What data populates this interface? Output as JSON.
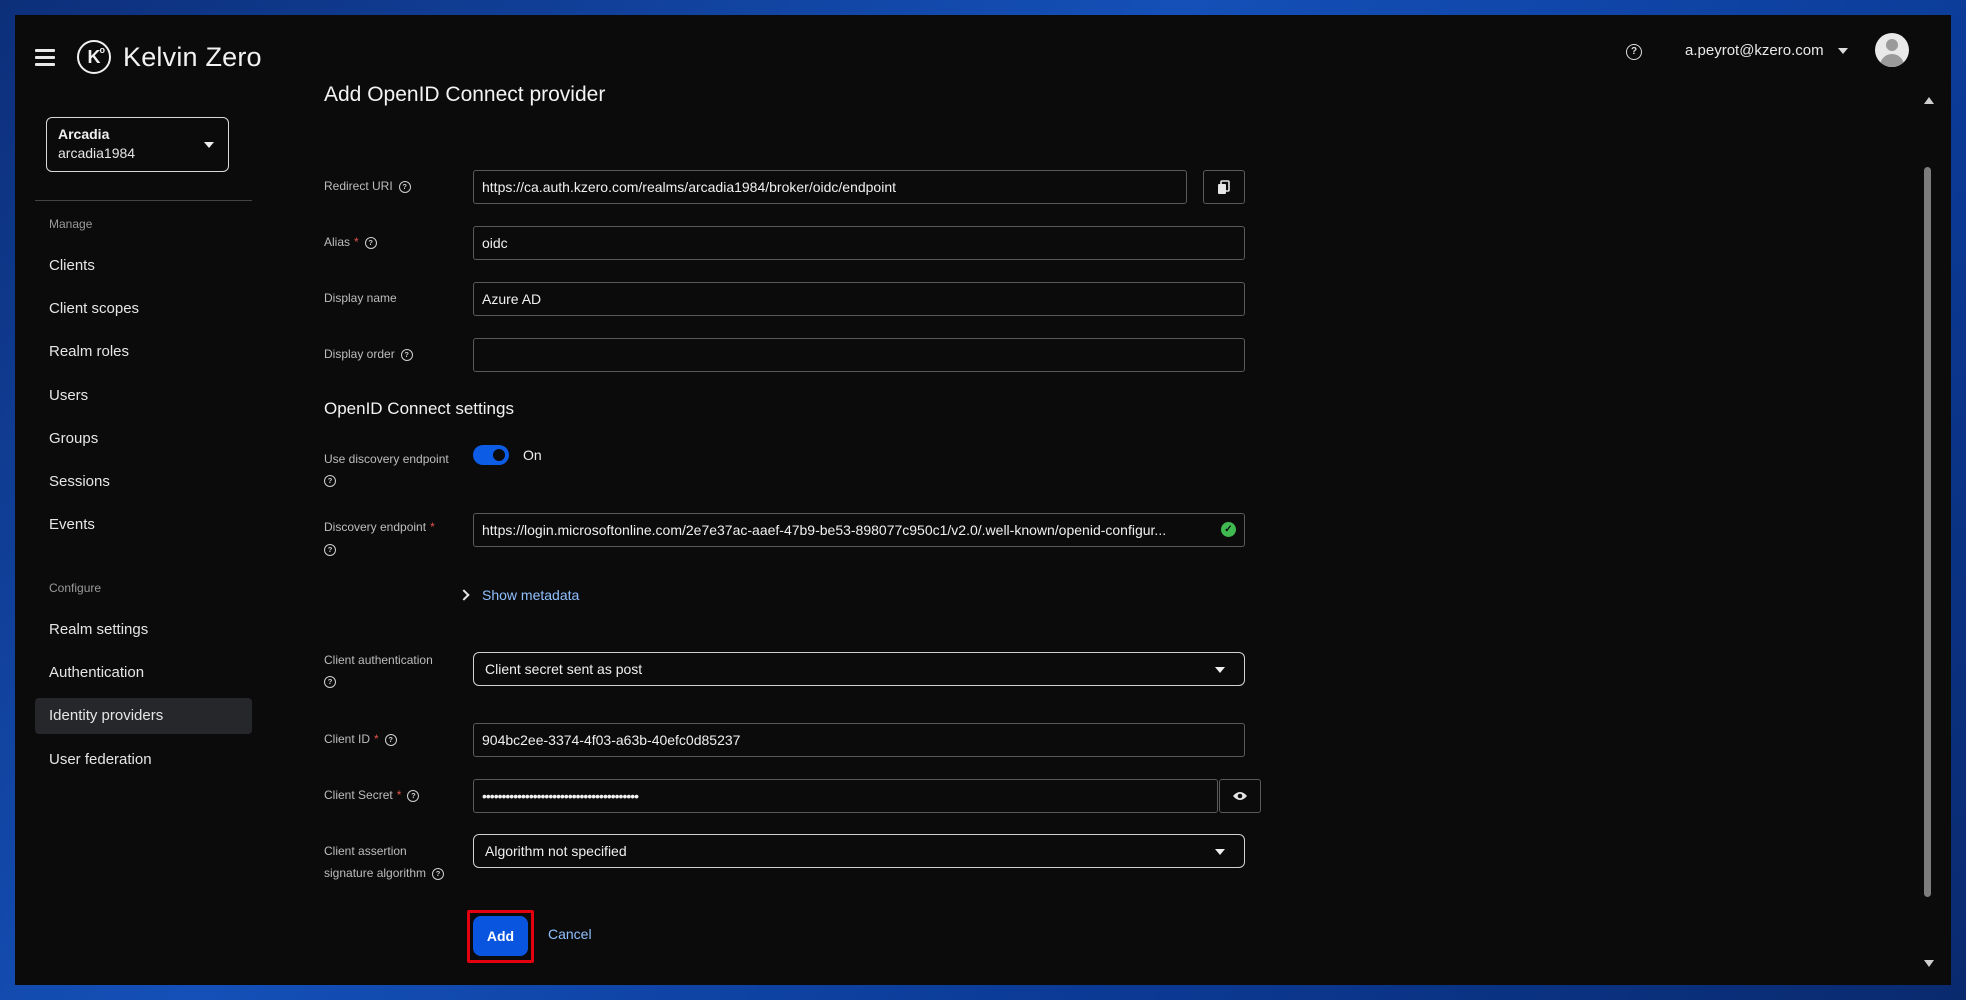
{
  "app": {
    "brand": "Kelvin Zero",
    "user_email": "a.peyrot@kzero.com"
  },
  "realm": {
    "name": "Arcadia",
    "id": "arcadia1984"
  },
  "sidebar": {
    "manage_heading": "Manage",
    "manage_items": [
      "Clients",
      "Client scopes",
      "Realm roles",
      "Users",
      "Groups",
      "Sessions",
      "Events"
    ],
    "configure_heading": "Configure",
    "configure_items": [
      "Realm settings",
      "Authentication",
      "Identity providers",
      "User federation"
    ],
    "active_item": "Identity providers"
  },
  "form": {
    "title": "Add OpenID Connect provider",
    "redirect_uri": {
      "label": "Redirect URI",
      "value": "https://ca.auth.kzero.com/realms/arcadia1984/broker/oidc/endpoint"
    },
    "alias": {
      "label": "Alias",
      "value": "oidc"
    },
    "display_name": {
      "label": "Display name",
      "value": "Azure AD"
    },
    "display_order": {
      "label": "Display order",
      "value": ""
    },
    "settings_heading": "OpenID Connect settings",
    "use_discovery": {
      "label": "Use discovery endpoint",
      "state_label": "On",
      "enabled": true
    },
    "discovery_endpoint": {
      "label": "Discovery endpoint",
      "value": "https://login.microsoftonline.com/2e7e37ac-aaef-47b9-be53-898077c950c1/v2.0/.well-known/openid-configur..."
    },
    "show_metadata": "Show metadata",
    "client_auth": {
      "label": "Client authentication",
      "value": "Client secret sent as post"
    },
    "client_id": {
      "label": "Client ID",
      "value": "904bc2ee-3374-4f03-a63b-40efc0d85237"
    },
    "client_secret": {
      "label": "Client Secret",
      "value": "••••••••••••••••••••••••••••••••••••••••"
    },
    "client_assertion": {
      "label_line1": "Client assertion",
      "label_line2": "signature algorithm",
      "value": "Algorithm not specified"
    },
    "add_label": "Add",
    "cancel_label": "Cancel"
  },
  "colors": {
    "accent": "#0a55e0",
    "link": "#8fc1ff",
    "required": "#e2534b",
    "highlight": "#e3000f"
  }
}
